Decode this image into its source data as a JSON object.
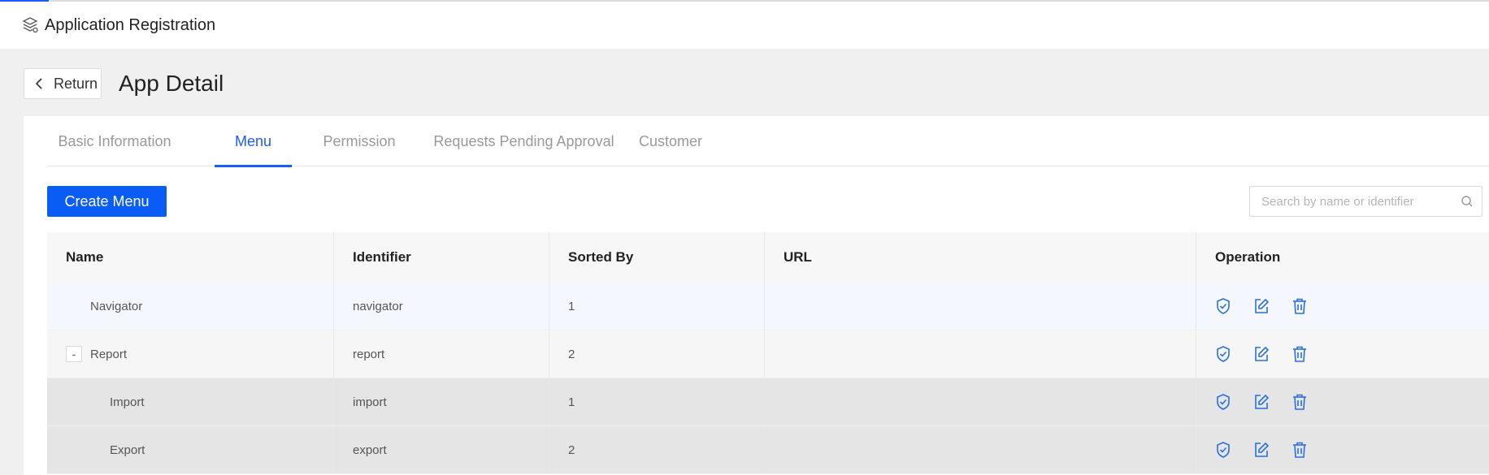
{
  "header": {
    "app_title": "Application Registration"
  },
  "page": {
    "return_label": "Return",
    "title": "App Detail"
  },
  "tabs": [
    {
      "label": "Basic Information",
      "active": false
    },
    {
      "label": "Menu",
      "active": true
    },
    {
      "label": "Permission",
      "active": false
    },
    {
      "label": "Requests Pending Approval",
      "active": false
    },
    {
      "label": "Customer",
      "active": false
    }
  ],
  "toolbar": {
    "create_label": "Create Menu",
    "search_placeholder": "Search by name or identifier"
  },
  "table": {
    "columns": [
      "Name",
      "Identifier",
      "Sorted By",
      "URL",
      "Operation"
    ],
    "rows": [
      {
        "name": "Navigator",
        "identifier": "navigator",
        "sorted_by": "1",
        "url": ""
      },
      {
        "name": "Report",
        "identifier": "report",
        "sorted_by": "2",
        "url": "",
        "expander": "-"
      },
      {
        "name": "Import",
        "identifier": "import",
        "sorted_by": "1",
        "url": ""
      },
      {
        "name": "Export",
        "identifier": "export",
        "sorted_by": "2",
        "url": ""
      }
    ]
  },
  "colors": {
    "accent": "#1a5cff",
    "button": "#0a5cf5",
    "icon": "#2a6fe0"
  },
  "icons": {
    "app": "layers-icon",
    "operations": [
      "permission-shield-icon",
      "edit-icon",
      "delete-icon"
    ]
  }
}
